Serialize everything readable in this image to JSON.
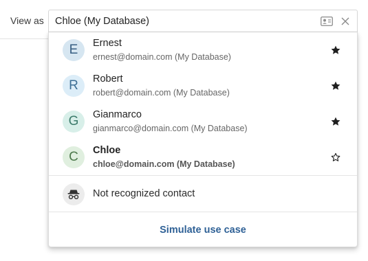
{
  "view_as": {
    "label": "View as",
    "selected_value": "Chloe (My Database)"
  },
  "contacts": [
    {
      "initial": "E",
      "name": "Ernest",
      "email": "ernest@domain.com (My Database)",
      "starred": true,
      "avatar_bg": "#d6e6f1",
      "avatar_fg": "#375f82"
    },
    {
      "initial": "R",
      "name": "Robert",
      "email": "robert@domain.com (My Database)",
      "starred": true,
      "avatar_bg": "#dcedf8",
      "avatar_fg": "#3d6f95"
    },
    {
      "initial": "G",
      "name": "Gianmarco",
      "email": "gianmarco@domain.com (My Database)",
      "starred": true,
      "avatar_bg": "#d8efe9",
      "avatar_fg": "#3c7b6b"
    },
    {
      "initial": "C",
      "name": "Chloe",
      "email": "chloe@domain.com (My Database)",
      "starred": false,
      "selected": true,
      "avatar_bg": "#e0efdf",
      "avatar_fg": "#4d7a4c"
    }
  ],
  "unknown_contact": {
    "label": "Not recognized contact",
    "icon": "incognito-icon"
  },
  "actions": {
    "simulate_label": "Simulate use case"
  },
  "icons": {
    "contact_card": "contact-card-icon",
    "clear": "close-icon",
    "star_filled": "star-filled-icon",
    "star_outline": "star-outline-icon"
  },
  "colors": {
    "link": "#2f6196"
  }
}
